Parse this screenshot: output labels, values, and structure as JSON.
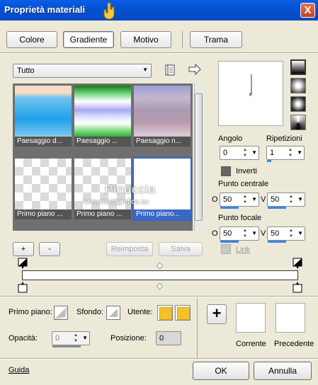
{
  "window": {
    "title": "Proprietà materiali",
    "close_label": "X"
  },
  "tabs": [
    {
      "label": "Colore",
      "active": false
    },
    {
      "label": "Gradiente",
      "active": true
    },
    {
      "label": "Motivo",
      "active": false
    },
    {
      "label": "Trama",
      "active": false
    }
  ],
  "category": {
    "selected": "Tutto"
  },
  "presets": [
    {
      "label": "Paesaggio d...",
      "swatch": "sky"
    },
    {
      "label": "Paesaggio ...",
      "swatch": "green"
    },
    {
      "label": "Paesaggio n...",
      "swatch": "mauve"
    },
    {
      "label": "Primo piano ...",
      "swatch": "checker"
    },
    {
      "label": "Primo piano ...",
      "swatch": "checker2"
    },
    {
      "label": "Primo piano...",
      "swatch": "white",
      "selected": true
    }
  ],
  "watermark": {
    "line1": "Pinuccia",
    "line2": "www.maidigrafica.eu"
  },
  "list_buttons": {
    "add": "+",
    "remove": "-",
    "reset": "Reimposta",
    "save": "Salva"
  },
  "angle": {
    "label": "Angolo",
    "value": "0"
  },
  "repeats": {
    "label": "Ripetizioni",
    "value": "1"
  },
  "invert": {
    "label": "Inverti",
    "checked": true
  },
  "center_point": {
    "label": "Punto centrale",
    "h_label": "O",
    "h_value": "50",
    "v_label": "V",
    "v_value": "50"
  },
  "focal_point": {
    "label": "Punto focale",
    "h_label": "O",
    "h_value": "50",
    "v_label": "V",
    "v_value": "50"
  },
  "link": {
    "label": "Link",
    "checked": false
  },
  "bottom": {
    "foreground_label": "Primo piano:",
    "background_label": "Sfondo:",
    "user_label": "Utente:",
    "opacity_label": "Opacità:",
    "opacity_value": "0",
    "position_label": "Posizione:",
    "position_value": "0",
    "add_button": "+",
    "current_label": "Corrente",
    "previous_label": "Precedente"
  },
  "footer": {
    "help": "Guida",
    "ok": "OK",
    "cancel": "Annulla"
  },
  "colors": {
    "titlebar": "#0a5fe6",
    "user_swatch": "#f2c12e",
    "accent": "#3a67c6"
  }
}
